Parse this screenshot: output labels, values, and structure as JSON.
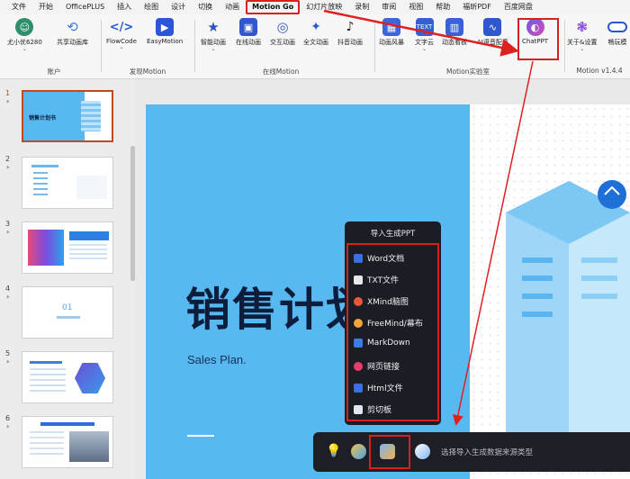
{
  "menubar": {
    "items": [
      "文件",
      "开始",
      "OfficePLUS",
      "插入",
      "绘图",
      "设计",
      "切换",
      "动画",
      "Motion Go",
      "幻灯片放映",
      "录制",
      "审阅",
      "视图",
      "帮助",
      "福昕PDF",
      "百度网盘"
    ],
    "active": "Motion Go"
  },
  "ribbon": {
    "account": {
      "user_label": "尤小优6280",
      "lib_label": "共享动画库",
      "group_label": "账户"
    },
    "develop": {
      "flowcode_label": "FlowCode",
      "easymotion_label": "EasyMotion",
      "group_label": "发现Motion"
    },
    "online": {
      "smart_label": "智能动画",
      "online_label": "在线动画",
      "interactive_label": "交互动画",
      "fulltext_label": "全文动画",
      "douyin_label": "抖音动画",
      "group_label": "在线Motion"
    },
    "lab": {
      "scene_label": "动画风暴",
      "textcloud_label": "文字云",
      "chart_label": "动态看板",
      "voice_label": "AI语音配音",
      "chatppt_label": "ChatPPT",
      "group_label": "Motion实验室"
    },
    "settings": {
      "about_label": "关于&设置",
      "smooth_label": "畅玩模",
      "group_label": "Motion v1.4.4"
    }
  },
  "thumbnails": {
    "numbers": [
      "1",
      "2",
      "3",
      "4",
      "5",
      "6"
    ],
    "star": "*",
    "slide1_title": "销售计划书",
    "slide4_num": "01"
  },
  "slide": {
    "title": "销售计划书",
    "subtitle": "Sales Plan."
  },
  "popup": {
    "title": "导入生成PPT",
    "items": [
      "Word文档",
      "TXT文件",
      "XMind脑图",
      "FreeMind/幕布",
      "MarkDown",
      "网页链接",
      "Html文件",
      "剪切板"
    ]
  },
  "bottombar": {
    "hint": "选择导入生成数据来源类型"
  },
  "colors": {
    "accent_red": "#d81e1e",
    "slide_blue": "#58b9f0",
    "title_navy": "#0d1e3d",
    "popup_bg": "#1c1c24"
  }
}
